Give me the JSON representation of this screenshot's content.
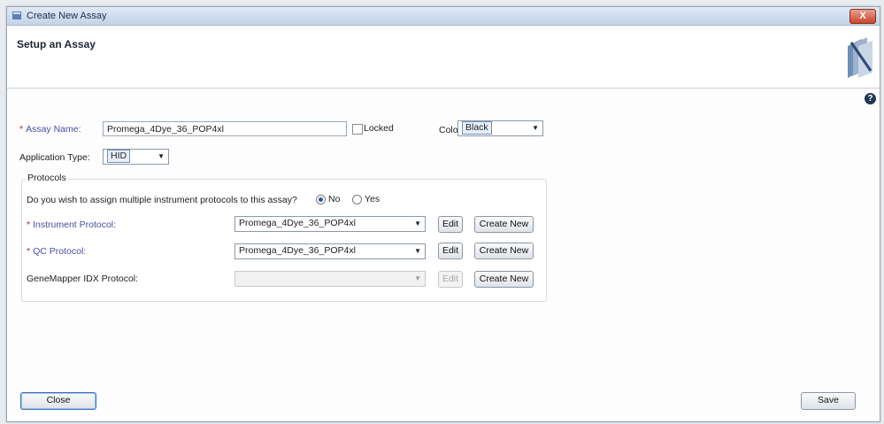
{
  "window": {
    "title": "Create New Assay",
    "close_label": "X"
  },
  "header": {
    "heading": "Setup an Assay",
    "help_label": "?"
  },
  "form": {
    "assay_name_label": "Assay Name:",
    "assay_name_value": "Promega_4Dye_36_POP4xl",
    "locked_label": "Locked",
    "color_label": "Color:",
    "color_value": "Black",
    "application_type_label": "Application Type:",
    "application_type_value": "HID"
  },
  "protocols": {
    "group_title": "Protocols",
    "question": "Do you wish to assign multiple instrument protocols to this assay?",
    "option_no": "No",
    "option_yes": "Yes",
    "selected": "No",
    "rows": [
      {
        "label": "Instrument Protocol:",
        "required": true,
        "value": "Promega_4Dye_36_POP4xl",
        "edit": "Edit",
        "create": "Create New",
        "enabled": true
      },
      {
        "label": "QC Protocol:",
        "required": true,
        "value": "Promega_4Dye_36_POP4xl",
        "edit": "Edit",
        "create": "Create New",
        "enabled": true
      },
      {
        "label": "GeneMapper IDX Protocol:",
        "required": false,
        "value": "",
        "edit": "Edit",
        "create": "Create New",
        "enabled": false
      }
    ]
  },
  "footer": {
    "close_label": "Close",
    "save_label": "Save"
  }
}
